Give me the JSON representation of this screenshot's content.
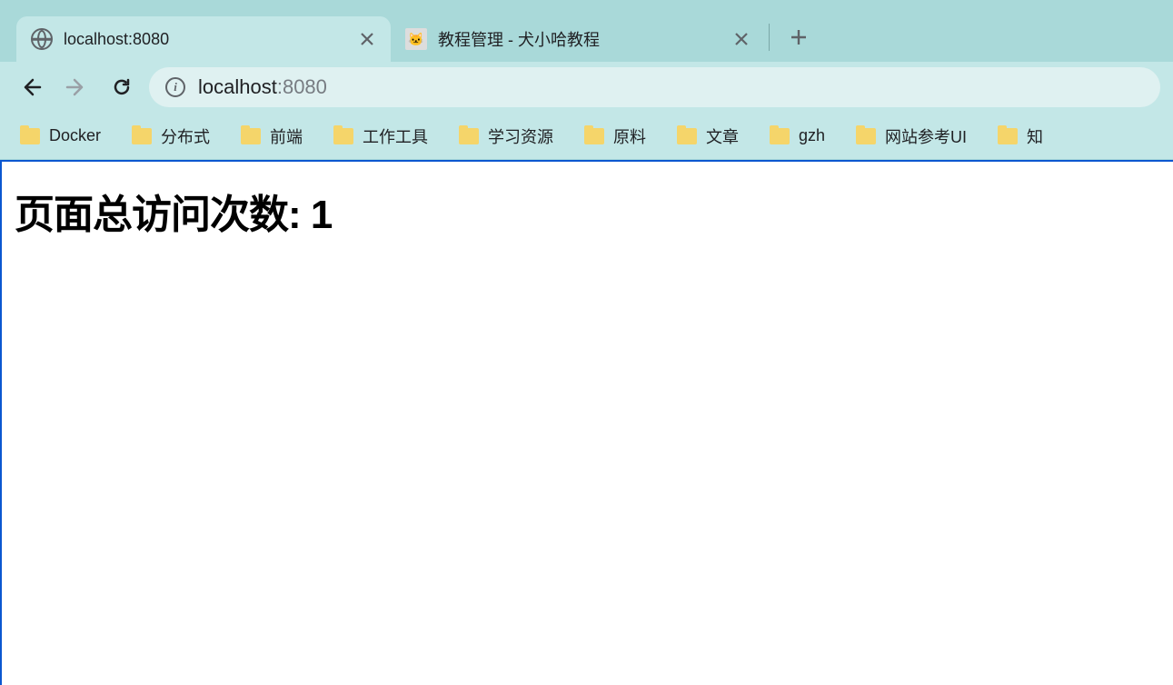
{
  "tabs": [
    {
      "title": "localhost:8080",
      "active": true
    },
    {
      "title": "教程管理 - 犬小哈教程",
      "active": false
    }
  ],
  "address": {
    "host": "localhost",
    "port": ":8080"
  },
  "bookmarks": [
    {
      "label": "Docker"
    },
    {
      "label": "分布式"
    },
    {
      "label": "前端"
    },
    {
      "label": "工作工具"
    },
    {
      "label": "学习资源"
    },
    {
      "label": "原料"
    },
    {
      "label": "文章"
    },
    {
      "label": "gzh"
    },
    {
      "label": "网站参考UI"
    },
    {
      "label": "知"
    }
  ],
  "page": {
    "heading": "页面总访问次数: 1"
  }
}
